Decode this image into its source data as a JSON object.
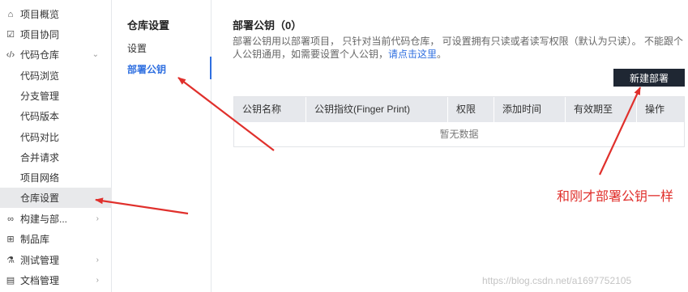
{
  "sidebar": {
    "items": [
      {
        "label": "项目概览",
        "icon": "home-icon"
      },
      {
        "label": "项目协同",
        "icon": "checkbox-icon"
      },
      {
        "label": "代码仓库",
        "icon": "code-icon"
      },
      {
        "label": "代码浏览"
      },
      {
        "label": "分支管理"
      },
      {
        "label": "代码版本"
      },
      {
        "label": "代码对比"
      },
      {
        "label": "合并请求"
      },
      {
        "label": "项目网络"
      },
      {
        "label": "仓库设置"
      },
      {
        "label": "构建与部...",
        "icon": "infinity-icon"
      },
      {
        "label": "制品库",
        "icon": "package-icon"
      },
      {
        "label": "测试管理",
        "icon": "flask-icon"
      },
      {
        "label": "文档管理",
        "icon": "document-icon"
      }
    ]
  },
  "settings_nav": {
    "title": "仓库设置",
    "items": [
      {
        "label": "设置"
      },
      {
        "label": "部署公钥"
      }
    ]
  },
  "main": {
    "title": "部署公钥（0）",
    "description": "部署公钥用以部署项目， 只针对当前代码仓库， 可设置拥有只读或者读写权限（默认为只读）。 不能跟个人公钥通用，如需要设置个人公钥，",
    "link_text": "请点击这里",
    "description_end": "。",
    "new_button": "新建部署",
    "table": {
      "columns": [
        "公钥名称",
        "公钥指纹(Finger Print)",
        "权限",
        "添加时间",
        "有效期至",
        "操作"
      ],
      "empty_text": "暂无数据"
    }
  },
  "annotation": {
    "text": "和刚才部署公钥一样",
    "color": "#e0302c"
  },
  "watermark": "https://blog.csdn.net/a1697752105",
  "colors": {
    "accent": "#2f6fe0",
    "button_bg": "#1f2733",
    "header_bg": "#e6e8ec",
    "active_bg": "#e8e9eb"
  }
}
